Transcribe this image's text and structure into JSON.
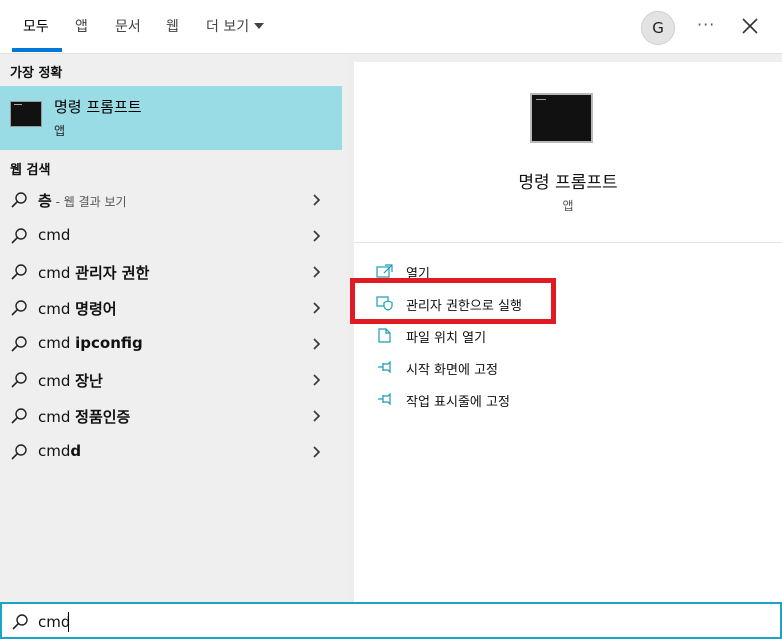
{
  "tabs": [
    {
      "label": "모두"
    },
    {
      "label": "앱"
    },
    {
      "label": "문서"
    },
    {
      "label": "웹"
    },
    {
      "label": "더 보기"
    }
  ],
  "user": {
    "avatar_letter": "G"
  },
  "header": {
    "more_label": "···"
  },
  "left": {
    "best_match_header": "가장 정확",
    "best_match": {
      "title": "명령 프롬프트",
      "subtitle": "앱",
      "icon": "cmd-icon"
    },
    "web_header": "웹 검색",
    "web_results": [
      {
        "bold": "층",
        "rest": " - 웹 결과 보기",
        "type": "bold-first"
      },
      {
        "plain": "cmd",
        "bold": ""
      },
      {
        "plain": "cmd ",
        "bold": "관리자 권한"
      },
      {
        "plain": "cmd ",
        "bold": "명령어"
      },
      {
        "plain": "cmd ",
        "bold": "ipconfig"
      },
      {
        "plain": "cmd ",
        "bold": "장난"
      },
      {
        "plain": "cmd ",
        "bold": "정품인증"
      },
      {
        "plain": "cmd",
        "bold": "d"
      }
    ]
  },
  "right": {
    "title": "명령 프롬프트",
    "subtitle": "앱",
    "actions": [
      {
        "label": "열기",
        "icon": "open-icon"
      },
      {
        "label": "관리자 권한으로 실행",
        "icon": "shield-icon"
      },
      {
        "label": "파일 위치 열기",
        "icon": "file-location-icon"
      },
      {
        "label": "시작 화면에 고정",
        "icon": "pin-icon"
      },
      {
        "label": "작업 표시줄에 고정",
        "icon": "pin-icon"
      }
    ]
  },
  "search": {
    "value": "cmd"
  },
  "colors": {
    "accent": "#0078d7",
    "selection": "#9adce6",
    "highlight_box": "#e01b24",
    "search_border": "#1aa4c8"
  }
}
